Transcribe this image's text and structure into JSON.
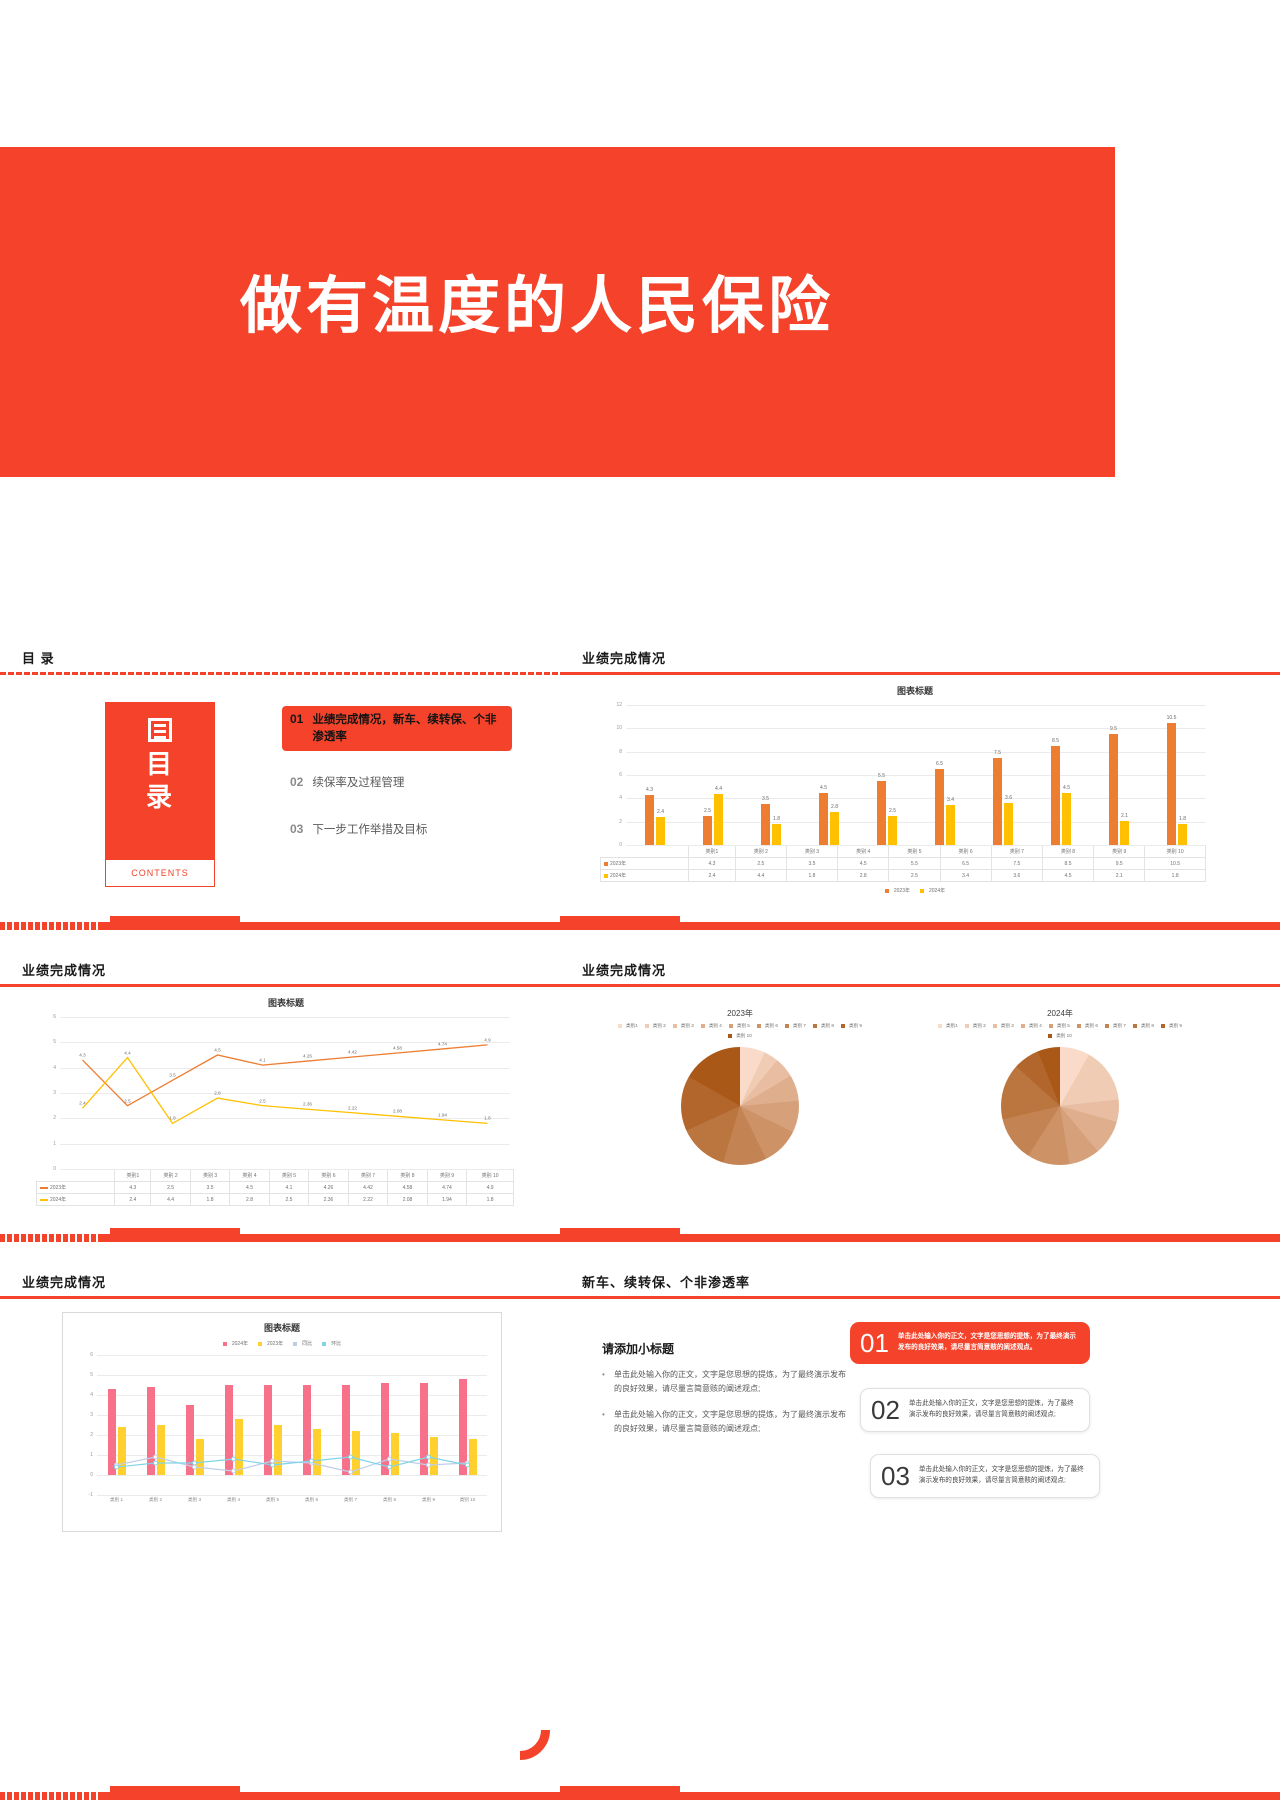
{
  "title_slide": {
    "heading": "做有温度的人民保险"
  },
  "toc_slide": {
    "head": "目  录",
    "card_text": "目\n录",
    "contents_label": "CONTENTS",
    "items": [
      {
        "num": "01",
        "label": "业绩完成情况，新车、续转保、个非渗透率",
        "active": true
      },
      {
        "num": "02",
        "label": "续保率及过程管理",
        "active": false
      },
      {
        "num": "03",
        "label": "下一步工作举措及目标",
        "active": false
      }
    ]
  },
  "bar_slide": {
    "head": "业绩完成情况"
  },
  "line_slide": {
    "head": "业绩完成情况"
  },
  "pie_slide": {
    "head": "业绩完成情况"
  },
  "combo_slide": {
    "head": "业绩完成情况"
  },
  "list_slide": {
    "head": "新车、续转保、个非渗透率",
    "sub_head": "请添加小标题",
    "bullets": [
      "单击此处输入你的正文，文字是您思想的提炼，为了最终演示发布的良好效果，请尽量言简意赅的阐述观点;",
      "单击此处输入你的正文，文字是您思想的提炼，为了最终演示发布的良好效果，请尽量言简意赅的阐述观点;"
    ],
    "boxes": [
      {
        "num": "01",
        "text": "单击此处输入你的正文，文字是您思想的提炼，为了最终演示发布的良好效果，请尽量言简意赅的阐述观点。"
      },
      {
        "num": "02",
        "text": "单击此处输入你的正文，文字是您思想的提炼，为了最终演示发布的良好效果，请尽量言简意赅的阐述观点;"
      },
      {
        "num": "03",
        "text": "单击此处输入你的正文，文字是您思想的提炼，为了最终演示发布的良好效果，请尽量言简意赅的阐述观点;"
      }
    ]
  },
  "colors": {
    "brand": "#F4432A",
    "series_2023": "#ED7D31",
    "series_2024": "#FFC000",
    "combo_2024": "#F8718B",
    "combo_2023": "#FFD02E",
    "combo_tongbi": "#BFCEE8",
    "combo_huanbi": "#7FD4E8"
  },
  "chart_data": [
    {
      "id": "bar",
      "type": "bar",
      "title": "图表标题",
      "categories": [
        "类别1",
        "类别 2",
        "类别 3",
        "类别 4",
        "类别 5",
        "类别 6",
        "类别 7",
        "类别 8",
        "类别 9",
        "类别 10"
      ],
      "series": [
        {
          "name": "2023年",
          "color": "#ED7D31",
          "values": [
            4.3,
            2.5,
            3.5,
            4.5,
            5.5,
            6.5,
            7.5,
            8.5,
            9.5,
            10.5
          ]
        },
        {
          "name": "2024年",
          "color": "#FFC000",
          "values": [
            2.4,
            4.4,
            1.8,
            2.8,
            2.5,
            3.4,
            3.6,
            4.5,
            2.1,
            1.8
          ]
        }
      ],
      "ylim": [
        0,
        12
      ],
      "yticks": [
        0,
        2,
        4,
        6,
        8,
        10,
        12
      ],
      "grid": true,
      "legend": "bottom",
      "xlabel": "",
      "ylabel": ""
    },
    {
      "id": "line",
      "type": "line",
      "title": "图表标题",
      "categories": [
        "类别1",
        "类别 2",
        "类别 3",
        "类别 4",
        "类别 5",
        "类别 6",
        "类别 7",
        "类别 8",
        "类别 9",
        "类别 10"
      ],
      "series": [
        {
          "name": "2023年",
          "color": "#ED7D31",
          "values": [
            4.3,
            2.5,
            3.5,
            4.5,
            4.1,
            4.26,
            4.42,
            4.58,
            4.74,
            4.9
          ]
        },
        {
          "name": "2024年",
          "color": "#FFC000",
          "values": [
            2.4,
            4.4,
            1.8,
            2.8,
            2.5,
            2.36,
            2.22,
            2.08,
            1.94,
            1.8
          ]
        }
      ],
      "ylim": [
        0,
        6
      ],
      "yticks": [
        0,
        1,
        2,
        3,
        4,
        5,
        6
      ],
      "grid": true,
      "legend": "none"
    },
    {
      "id": "pie2023",
      "type": "pie",
      "title": "2023年",
      "labels": [
        "类别1",
        "类别 2",
        "类别 3",
        "类别 4",
        "类别 5",
        "类别 6",
        "类别 7",
        "类别 8",
        "类别 9",
        "类别 10"
      ],
      "values": [
        4.3,
        2.5,
        3.5,
        4.5,
        5.5,
        6.5,
        7.5,
        8.5,
        9.5,
        10.5
      ],
      "legend": "top"
    },
    {
      "id": "pie2024",
      "type": "pie",
      "title": "2024年",
      "labels": [
        "类别1",
        "类别 2",
        "类别 3",
        "类别 4",
        "类别 5",
        "类别 6",
        "类别 7",
        "类别 8",
        "类别 9",
        "类别 10"
      ],
      "values": [
        2.4,
        4.4,
        1.8,
        2.8,
        2.5,
        3.4,
        3.6,
        4.5,
        2.1,
        1.8
      ],
      "legend": "top"
    },
    {
      "id": "combo",
      "type": "bar",
      "title": "图表标题",
      "categories": [
        "类别 1",
        "类别 2",
        "类别 3",
        "类别 4",
        "类别 5",
        "类别 6",
        "类别 7",
        "类别 8",
        "类别 9",
        "类别 10"
      ],
      "series": [
        {
          "name": "2024年",
          "color": "#F8718B",
          "kind": "bar",
          "values": [
            4.3,
            4.4,
            3.5,
            4.5,
            4.5,
            4.5,
            4.5,
            4.6,
            4.6,
            4.8
          ]
        },
        {
          "name": "2023年",
          "color": "#FFD02E",
          "kind": "bar",
          "values": [
            2.4,
            2.5,
            1.8,
            2.8,
            2.5,
            2.3,
            2.2,
            2.1,
            1.9,
            1.8
          ]
        },
        {
          "name": "同比",
          "color": "#BFCEE8",
          "kind": "line",
          "values": [
            0.5,
            0.9,
            0.4,
            0.2,
            0.7,
            0.6,
            0.15,
            0.8,
            0.5,
            0.6
          ]
        },
        {
          "name": "环比",
          "color": "#7FD4E8",
          "kind": "line",
          "values": [
            0.4,
            0.6,
            0.6,
            0.8,
            0.5,
            0.7,
            0.9,
            0.4,
            0.9,
            0.5
          ]
        }
      ],
      "ylim": [
        -1,
        6
      ],
      "yticks": [
        -1,
        0,
        1,
        2,
        3,
        4,
        5,
        6
      ],
      "grid": true,
      "legend": "top"
    }
  ]
}
